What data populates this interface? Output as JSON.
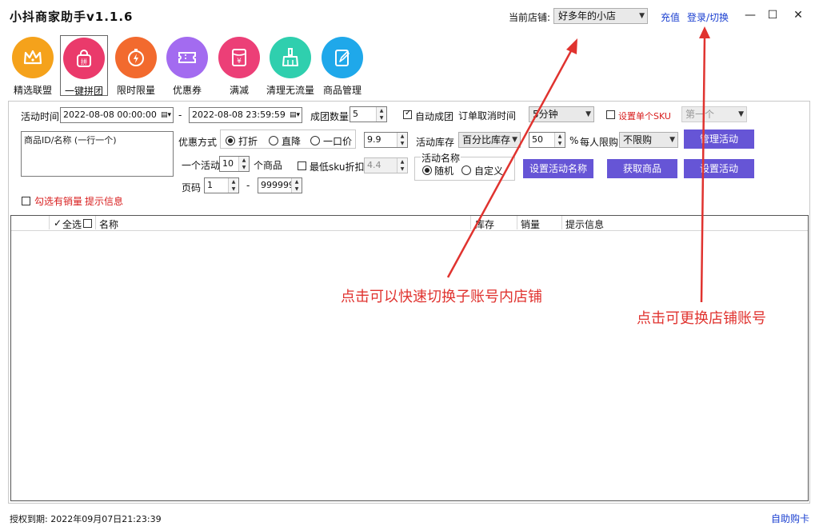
{
  "app": {
    "title": "小抖商家助手v1.1.6"
  },
  "header": {
    "store_label": "当前店铺:",
    "store_selected": "好多年的小店",
    "recharge_link": "充值",
    "login_link": "登录/切换",
    "window_controls": [
      "minimize-icon",
      "maximize-icon",
      "close-icon"
    ]
  },
  "toolbar": {
    "items": [
      {
        "label": "精选联盟",
        "icon": "crown-icon",
        "color": "#f5a21b"
      },
      {
        "label": "一键拼团",
        "icon": "bag-icon",
        "color": "#ea3a6b"
      },
      {
        "label": "限时限量",
        "icon": "timer-icon",
        "color": "#f26a2e"
      },
      {
        "label": "优惠券",
        "icon": "ticket-icon",
        "color": "#a36bf0"
      },
      {
        "label": "满减",
        "icon": "yen-icon",
        "color": "#ec3f77"
      },
      {
        "label": "清理无流量",
        "icon": "broom-icon",
        "color": "#2fcfae"
      },
      {
        "label": "商品管理",
        "icon": "edit-icon",
        "color": "#1fa8ea"
      }
    ]
  },
  "form": {
    "activity_time_label": "活动时间",
    "start_time": "2022-08-08 00:00:00",
    "time_separator": "-",
    "end_time": "2022-08-08 23:59:59",
    "group_size_label": "成团数量",
    "group_size_value": "5",
    "auto_group_label": "自动成团",
    "auto_group_checked": true,
    "order_cancel_label": "订单取消时间",
    "order_cancel_value": "5分钟",
    "single_sku_label": "设置单个SKU",
    "single_sku_value": "第一个",
    "product_textarea_placeholder": "商品ID/名称 (一行一个)",
    "discount_mode_label": "优惠方式",
    "discount_modes": [
      "打折",
      "直降",
      "一口价"
    ],
    "discount_value": "9.9",
    "stock_label": "活动库存",
    "stock_mode": "百分比库存",
    "stock_value": "50",
    "percent_label": "%",
    "limit_label": "每人限购",
    "limit_value": "不限购",
    "per_activity_label": "一个活动",
    "per_activity_value": "10",
    "products_unit_label": "个商品",
    "min_sku_label": "最低sku折扣",
    "min_sku_value": "4.4",
    "activity_name_group": "活动名称",
    "name_modes": [
      "随机",
      "自定义"
    ],
    "page_label": "页码",
    "page_start": "1",
    "page_separator": "-",
    "page_end": "999999",
    "only_sold_label": "勾选有销量",
    "hint_label": "提示信息",
    "buttons": {
      "manage": "管理活动",
      "set_name": "设置活动名称",
      "fetch": "获取商品",
      "set_activity": "设置活动"
    }
  },
  "table": {
    "select_all_label": "全选",
    "columns": [
      "名称",
      "库存",
      "销量",
      "提示信息"
    ]
  },
  "annotations": {
    "switch_store_hint": "点击可以快速切换子账号内店铺",
    "change_account_hint": "点击可更换店铺账号"
  },
  "footer": {
    "license_expiry": "授权到期: 2022年09月07日21:23:39",
    "self_service_card": "自助购卡"
  },
  "colors": {
    "accent_button": "#6655d6",
    "link": "#1a3fd0",
    "annotation": "#e0332f"
  }
}
